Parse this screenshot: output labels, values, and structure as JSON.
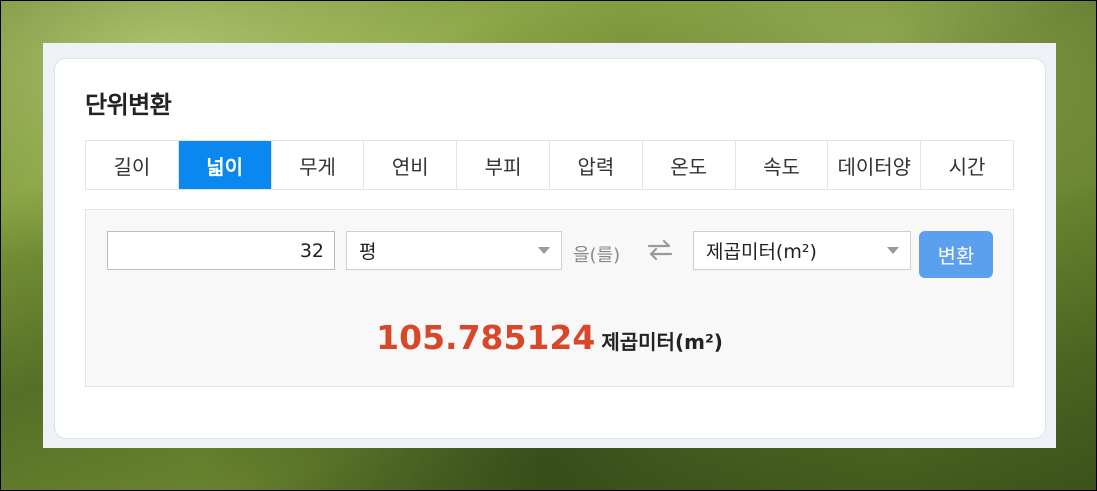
{
  "title": "단위변환",
  "tabs": [
    {
      "label": "길이",
      "active": false
    },
    {
      "label": "넓이",
      "active": true
    },
    {
      "label": "무게",
      "active": false
    },
    {
      "label": "연비",
      "active": false
    },
    {
      "label": "부피",
      "active": false
    },
    {
      "label": "압력",
      "active": false
    },
    {
      "label": "온도",
      "active": false
    },
    {
      "label": "속도",
      "active": false
    },
    {
      "label": "데이터양",
      "active": false
    },
    {
      "label": "시간",
      "active": false
    }
  ],
  "converter": {
    "input_value": "32",
    "from_unit": "평",
    "particle": "을(를)",
    "to_unit": "제곱미터(m²)",
    "convert_label": "변환",
    "result_value": "105.785124",
    "result_unit": "제곱미터(m²)"
  },
  "colors": {
    "active_tab": "#0b87f0",
    "button": "#5aa0ef",
    "result": "#d9472b"
  },
  "icons": {
    "swap": "swap-arrows-icon",
    "dropdown": "caret-down-icon"
  }
}
